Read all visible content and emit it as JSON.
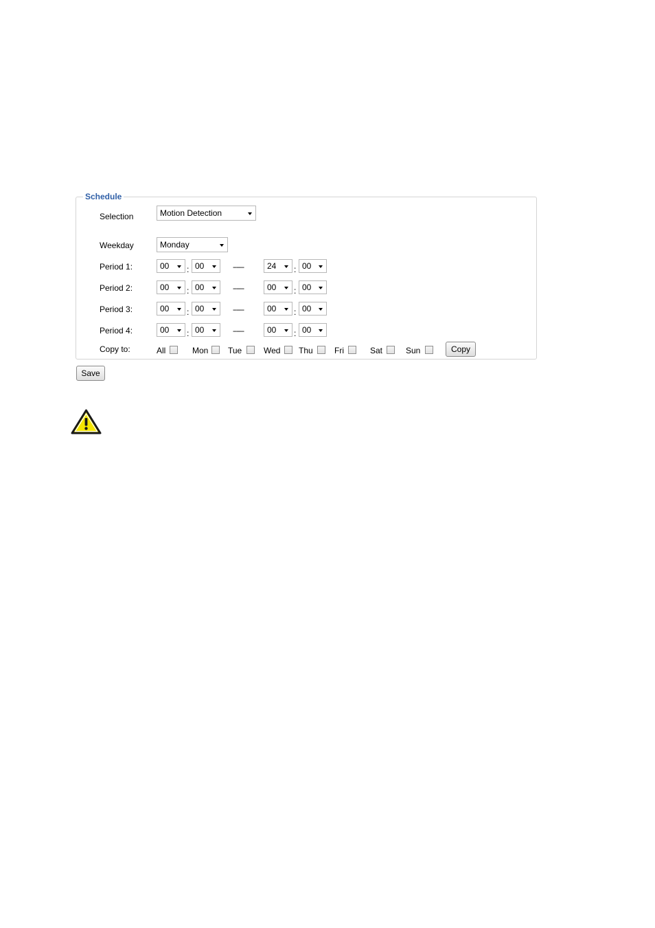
{
  "schedule": {
    "legend": "Schedule",
    "selection_label": "Selection",
    "selection_value": "Motion Detection",
    "weekday_label": "Weekday",
    "weekday_value": "Monday",
    "separator": "------",
    "colon": ":",
    "periods": [
      {
        "label": "Period 1:",
        "start_h": "00",
        "start_m": "00",
        "end_h": "24",
        "end_m": "00"
      },
      {
        "label": "Period 2:",
        "start_h": "00",
        "start_m": "00",
        "end_h": "00",
        "end_m": "00"
      },
      {
        "label": "Period 3:",
        "start_h": "00",
        "start_m": "00",
        "end_h": "00",
        "end_m": "00"
      },
      {
        "label": "Period 4:",
        "start_h": "00",
        "start_m": "00",
        "end_h": "00",
        "end_m": "00"
      }
    ],
    "copy_to_label": "Copy to:",
    "days": [
      "All",
      "Mon",
      "Tue",
      "Wed",
      "Thu",
      "Fri",
      "Sat",
      "Sun"
    ],
    "copy_button": "Copy"
  },
  "save_button": "Save",
  "icons": {
    "warning": "warning-triangle-icon"
  },
  "colors": {
    "legend": "#2f5fa7",
    "warning_fill": "#f5e600"
  }
}
